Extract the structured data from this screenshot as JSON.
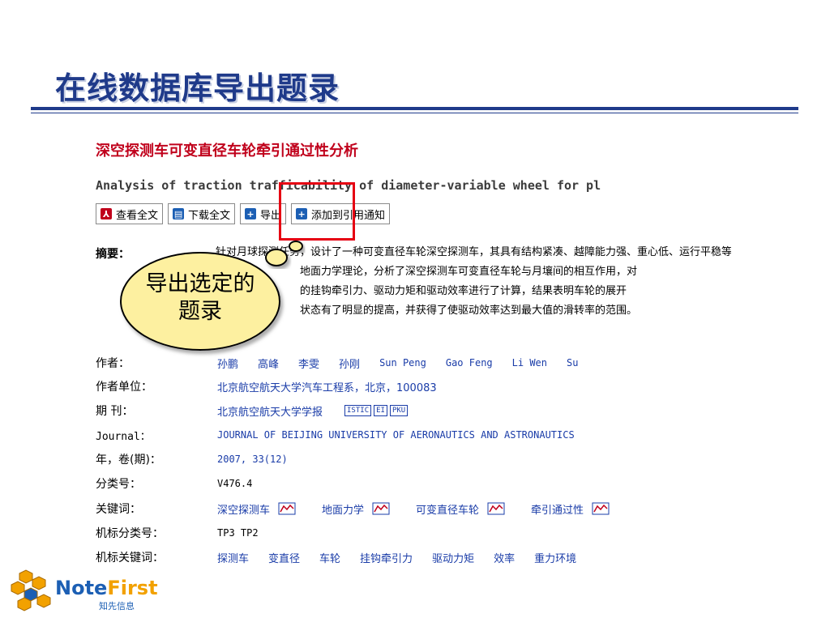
{
  "slide": {
    "title": "在线数据库导出题录"
  },
  "paper": {
    "title_cn": "深空探测车可变直径车轮牵引通过性分析",
    "title_en": "Analysis of traction trafficability of diameter-variable wheel for pl"
  },
  "toolbar": {
    "view_full": "查看全文",
    "download_full": "下载全文",
    "export": "导出",
    "add_citation": "添加到引用通知"
  },
  "abstract": {
    "label": "摘要：",
    "lines": [
      "针对月球探测任务，设计了一种可变直径车轮深空探测车，其具有结构紧凑、越障能力强、重心低、运行平稳等优",
      "地面力学理论，分析了深空探测车可变直径车轮与月壤间的相互作用，对",
      "的挂钩牵引力、驱动力矩和驱动效率进行了计算，结果表明车轮的展开",
      "状态有了明显的提高，并获得了使驱动效率达到最大值的滑转率的范围。"
    ]
  },
  "callout": {
    "line1": "导出选定的",
    "line2": "题录"
  },
  "meta": {
    "authors_label": "作者：",
    "authors": [
      "孙鹏",
      "高峰",
      "李雯",
      "孙刚",
      "Sun Peng",
      "Gao Feng",
      "Li Wen",
      "Su"
    ],
    "affiliation_label": "作者单位：",
    "affiliation": "北京航空航天大学汽车工程系，北京，100083",
    "journal_label": "期 刊：",
    "journal": "北京航空航天大学学报",
    "journal_tags": [
      "ISTIC",
      "EI",
      "PKU"
    ],
    "journal_en_label": "Journal：",
    "journal_en": "JOURNAL OF BEIJING UNIVERSITY OF AERONAUTICS AND ASTRONAUTICS",
    "year_label": "年，卷(期)：",
    "year": "2007, 33(12)",
    "class_label": "分类号：",
    "class": "V476.4",
    "keywords_label": "关键词：",
    "keywords": [
      "深空探测车",
      "地面力学",
      "可变直径车轮",
      "牵引通过性"
    ],
    "machine_class_label": "机标分类号：",
    "machine_class": "TP3 TP2",
    "machine_keywords_label": "机标关键词：",
    "machine_keywords": [
      "探测车",
      "变直径",
      "车轮",
      "挂钩牵引力",
      "驱动力矩",
      "效率",
      "重力环境"
    ]
  },
  "logo": {
    "name_a": "Note",
    "name_b": "First",
    "sub": "知先信息"
  },
  "colors": {
    "title": "#1f3a8a",
    "paper_title": "#c0001b",
    "link": "#1a3ca8",
    "highlight": "#e60012",
    "bubble": "#fdf0a0"
  }
}
